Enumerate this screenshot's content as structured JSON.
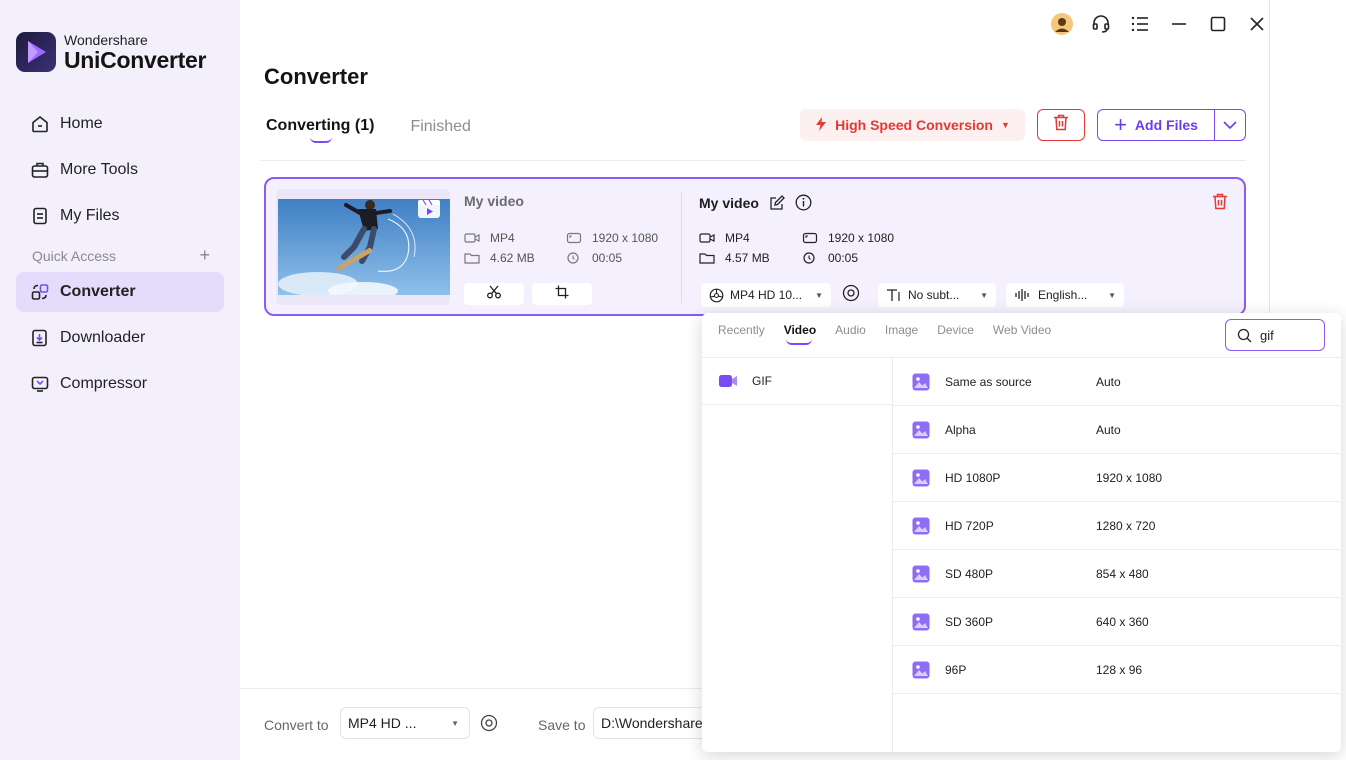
{
  "app": {
    "brand": "Wondershare",
    "product": "UniConverter"
  },
  "sidebar": {
    "items": [
      {
        "label": "Home",
        "icon": "home-icon"
      },
      {
        "label": "More Tools",
        "icon": "toolbox-icon"
      },
      {
        "label": "My Files",
        "icon": "file-icon"
      }
    ],
    "quick_access_label": "Quick Access",
    "quick_access_add": "+",
    "quick_items": [
      {
        "label": "Converter",
        "icon": "converter-icon",
        "active": true
      },
      {
        "label": "Downloader",
        "icon": "downloader-icon"
      },
      {
        "label": "Compressor",
        "icon": "compressor-icon"
      }
    ]
  },
  "titlebar": {
    "icons": [
      "avatar-icon",
      "headset-icon",
      "menu-icon",
      "minimize-icon",
      "maximize-icon",
      "close-icon"
    ]
  },
  "page": {
    "title": "Converter",
    "tabs": [
      {
        "label": "Converting (1)",
        "active": true
      },
      {
        "label": "Finished",
        "active": false
      }
    ]
  },
  "toolbar": {
    "high_speed_label": "High Speed Conversion",
    "add_files_label": "Add Files"
  },
  "file": {
    "source": {
      "name": "My video",
      "format": "MP4",
      "size": "4.62 MB",
      "resolution": "1920 x 1080",
      "duration": "00:05"
    },
    "output": {
      "name": "My video",
      "format": "MP4",
      "size": "4.57 MB",
      "resolution": "1920 x 1080",
      "duration": "00:05",
      "format_select": "MP4 HD 10...",
      "subtitle_select": "No subt...",
      "audio_select": "English..."
    }
  },
  "bottom": {
    "convert_to_label": "Convert to",
    "convert_to_value": "MP4 HD ...",
    "save_to_label": "Save to",
    "save_to_value": "D:\\Wondershare"
  },
  "format_popup": {
    "tabs": [
      "Recently",
      "Video",
      "Audio",
      "Image",
      "Device",
      "Web Video"
    ],
    "active_tab": "Video",
    "search_value": "gif",
    "categories": [
      {
        "label": "GIF"
      }
    ],
    "presets": [
      {
        "name": "Same as source",
        "resolution": "Auto"
      },
      {
        "name": "Alpha",
        "resolution": "Auto"
      },
      {
        "name": "HD 1080P",
        "resolution": "1920 x 1080"
      },
      {
        "name": "HD 720P",
        "resolution": "1280 x 720"
      },
      {
        "name": "SD 480P",
        "resolution": "854 x 480"
      },
      {
        "name": "SD 360P",
        "resolution": "640 x 360"
      },
      {
        "name": "96P",
        "resolution": "128 x 96"
      }
    ]
  },
  "colors": {
    "accent": "#7b4bf2",
    "danger": "#e53935",
    "sidebar_bg": "#f3f0fc",
    "active_nav_bg": "#e4dcfb"
  }
}
